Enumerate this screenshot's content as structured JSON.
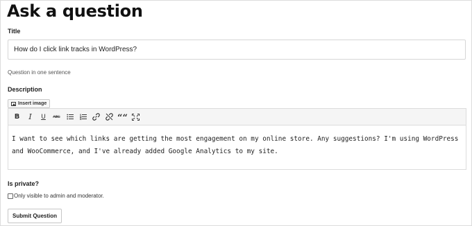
{
  "page": {
    "title": "Ask a question"
  },
  "form": {
    "title_label": "Title",
    "title_value": "How do I click link tracks in WordPress?",
    "title_hint": "Question in one sentence",
    "description_label": "Description",
    "insert_image_label": "Insert image",
    "toolbar": {
      "bold": "B",
      "italic": "I",
      "underline": "U",
      "strikethrough": "ABC",
      "quote": "“"
    },
    "description_text": "I want to see which links are getting the most engagement on my online store. Any suggestions? I'm using WordPress and WooCommerce, and I've already added Google Analytics to my site.",
    "private_label": "Is private?",
    "private_checkbox_label": "Only visible to admin and moderator.",
    "private_checked": false,
    "submit_label": "Submit Question"
  }
}
